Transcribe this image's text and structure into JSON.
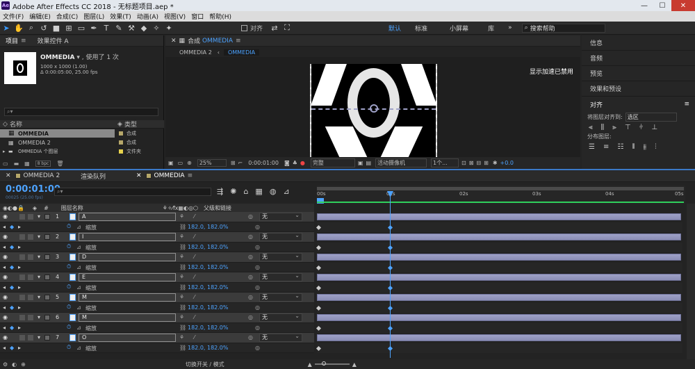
{
  "app": {
    "title": "Adobe After Effects CC 2018 - 无标题项目.aep *",
    "logo": "Ae"
  },
  "menu": [
    "文件(F)",
    "编辑(E)",
    "合成(C)",
    "图层(L)",
    "效果(T)",
    "动画(A)",
    "视图(V)",
    "窗口",
    "帮助(H)"
  ],
  "toolbar": {
    "align_label": "对齐",
    "workspaces": [
      "默认",
      "标准",
      "小屏幕",
      "库"
    ],
    "search_placeholder": "搜索帮助"
  },
  "project": {
    "tab1": "项目",
    "tab2": "效果控件 A",
    "item_name": "OMMEDIA",
    "item_used": "▾ , 使用了 1 次",
    "item_size": "1000 x 1000 (1.00)",
    "item_duration": "Δ 0:00:05:00, 25.00 fps",
    "col_name": "名称",
    "col_type": "类型",
    "rows": [
      {
        "name": "OMMEDIA",
        "type": "合成"
      },
      {
        "name": "OMMEDIA 2",
        "type": "合成"
      },
      {
        "name": "OMMEDIA 个图层",
        "type": "文件夹"
      }
    ],
    "bpc": "8 bpc"
  },
  "viewer": {
    "tab": "合成",
    "tab_name": "OMMEDIA",
    "crumbs": [
      "OMMEDIA 2",
      "OMMEDIA"
    ],
    "accel_msg": "显示加速已禁用",
    "zoom": "25%",
    "timecode": "0:00:01:00",
    "quality": "完整",
    "camera": "活动摄像机",
    "views": "1个...",
    "exposure": "+0.0"
  },
  "right": {
    "items": [
      "信息",
      "音频",
      "预览",
      "效果和预设",
      "对齐"
    ],
    "align_to_label": "将图层对齐到:",
    "align_to_value": "选区",
    "distribute_label": "分布图层:"
  },
  "timeline": {
    "tabs": [
      "OMMEDIA 2",
      "渲染队列",
      "OMMEDIA"
    ],
    "timecode": "0:00:01:00",
    "fps": "00025 (25.00 fps)",
    "col_hash": "#",
    "col_layername": "图层名称",
    "col_parent": "父级和链接",
    "ruler": [
      "00s",
      "01s",
      "02s",
      "03s",
      "04s",
      "05s"
    ],
    "layers": [
      {
        "num": "1",
        "name": "A",
        "parent": "无"
      },
      {
        "num": "2",
        "name": "I",
        "parent": "无"
      },
      {
        "num": "3",
        "name": "D",
        "parent": "无"
      },
      {
        "num": "4",
        "name": "E",
        "parent": "无"
      },
      {
        "num": "5",
        "name": "M",
        "parent": "无"
      },
      {
        "num": "6",
        "name": "M",
        "parent": "无"
      },
      {
        "num": "7",
        "name": "O",
        "parent": "无"
      }
    ],
    "prop_name": "缩放",
    "prop_value": "182.0, 182.0%",
    "footer_label": "切换开关 / 模式"
  }
}
